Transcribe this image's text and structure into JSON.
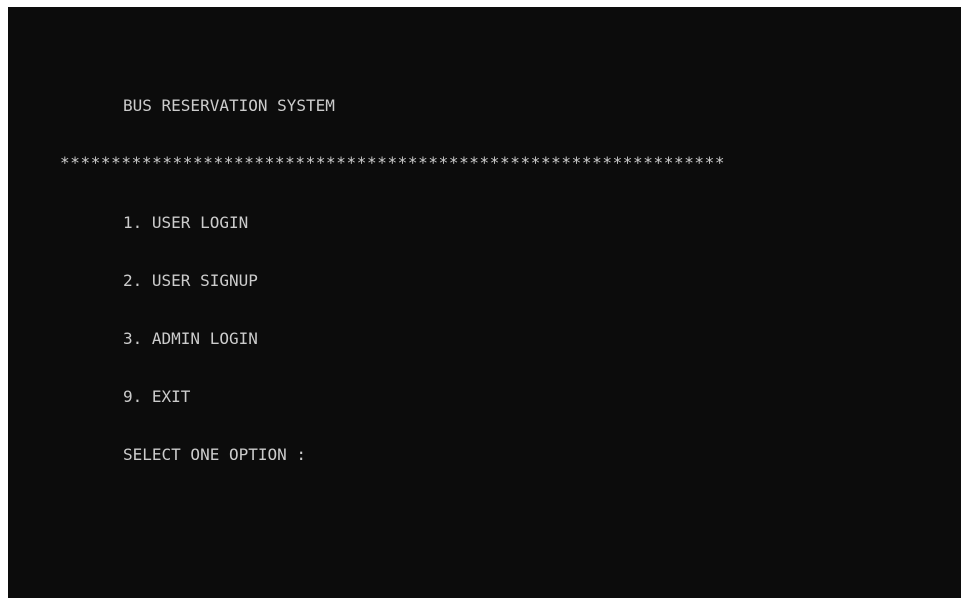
{
  "console": {
    "title": "BUS RESERVATION SYSTEM",
    "separator": "*****************************************************************",
    "options": [
      "1. USER LOGIN",
      "2. USER SIGNUP",
      "3. ADMIN LOGIN",
      "9. EXIT"
    ],
    "prompt": "SELECT ONE OPTION :",
    "colors": {
      "background": "#0c0c0c",
      "text": "#cccccc"
    }
  }
}
